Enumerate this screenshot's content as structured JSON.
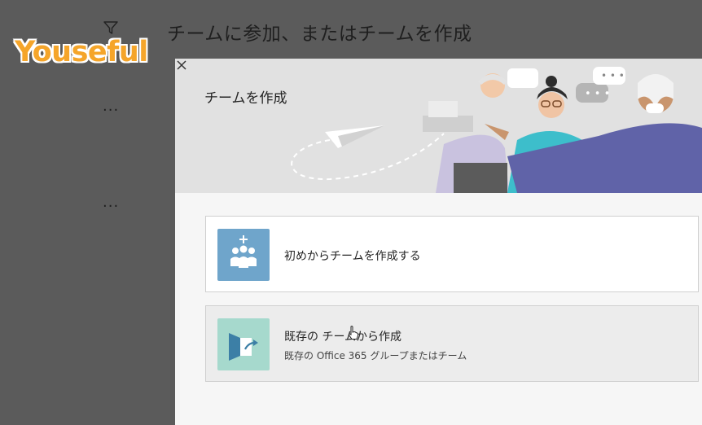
{
  "background": {
    "title": "チームに参加、またはチームを作成",
    "more_dots": "..."
  },
  "watermark": "Youseful",
  "dialog": {
    "title": "チームを作成",
    "options": [
      {
        "label": "初めからチームを作成する",
        "icon": "team-plus-icon"
      },
      {
        "label": "既存の チームから作成",
        "sublabel": "既存の Office 365 グループまたはチーム",
        "icon": "existing-team-arrow-icon"
      }
    ]
  },
  "colors": {
    "backdrop": "#5b5b5b",
    "dialog_bg": "#f6f6f6",
    "tile_blue": "#6fa5cb",
    "tile_teal": "#a6d9cd",
    "illustration_purple": "#6063a8"
  }
}
